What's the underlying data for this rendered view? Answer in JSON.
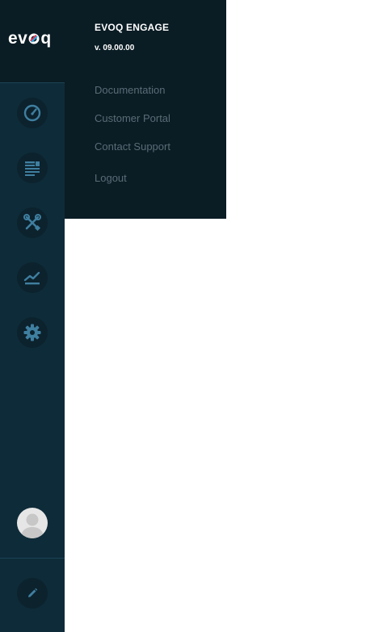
{
  "logo": {
    "text_before": "ev",
    "text_after": "q",
    "alt": "evoq"
  },
  "panel": {
    "product_name": "EVOQ ENGAGE",
    "version": "v. 09.00.00",
    "links": [
      {
        "label": "Documentation"
      },
      {
        "label": "Customer Portal"
      },
      {
        "label": "Contact Support"
      },
      {
        "label": "Logout"
      }
    ]
  },
  "sidebar": {
    "items": [
      {
        "icon": "dashboard-icon"
      },
      {
        "icon": "content-icon"
      },
      {
        "icon": "tools-icon"
      },
      {
        "icon": "analytics-icon"
      },
      {
        "icon": "settings-icon"
      }
    ],
    "bottom": {
      "avatar": "user-avatar",
      "edit": "pencil-icon"
    }
  },
  "colors": {
    "sidebar_bg": "#0e2b39",
    "panel_bg": "#0a1c24",
    "icon": "#3f7fa0",
    "link": "#5a6c76",
    "logo_red": "#e4324a",
    "logo_blue": "#2aa7de"
  }
}
